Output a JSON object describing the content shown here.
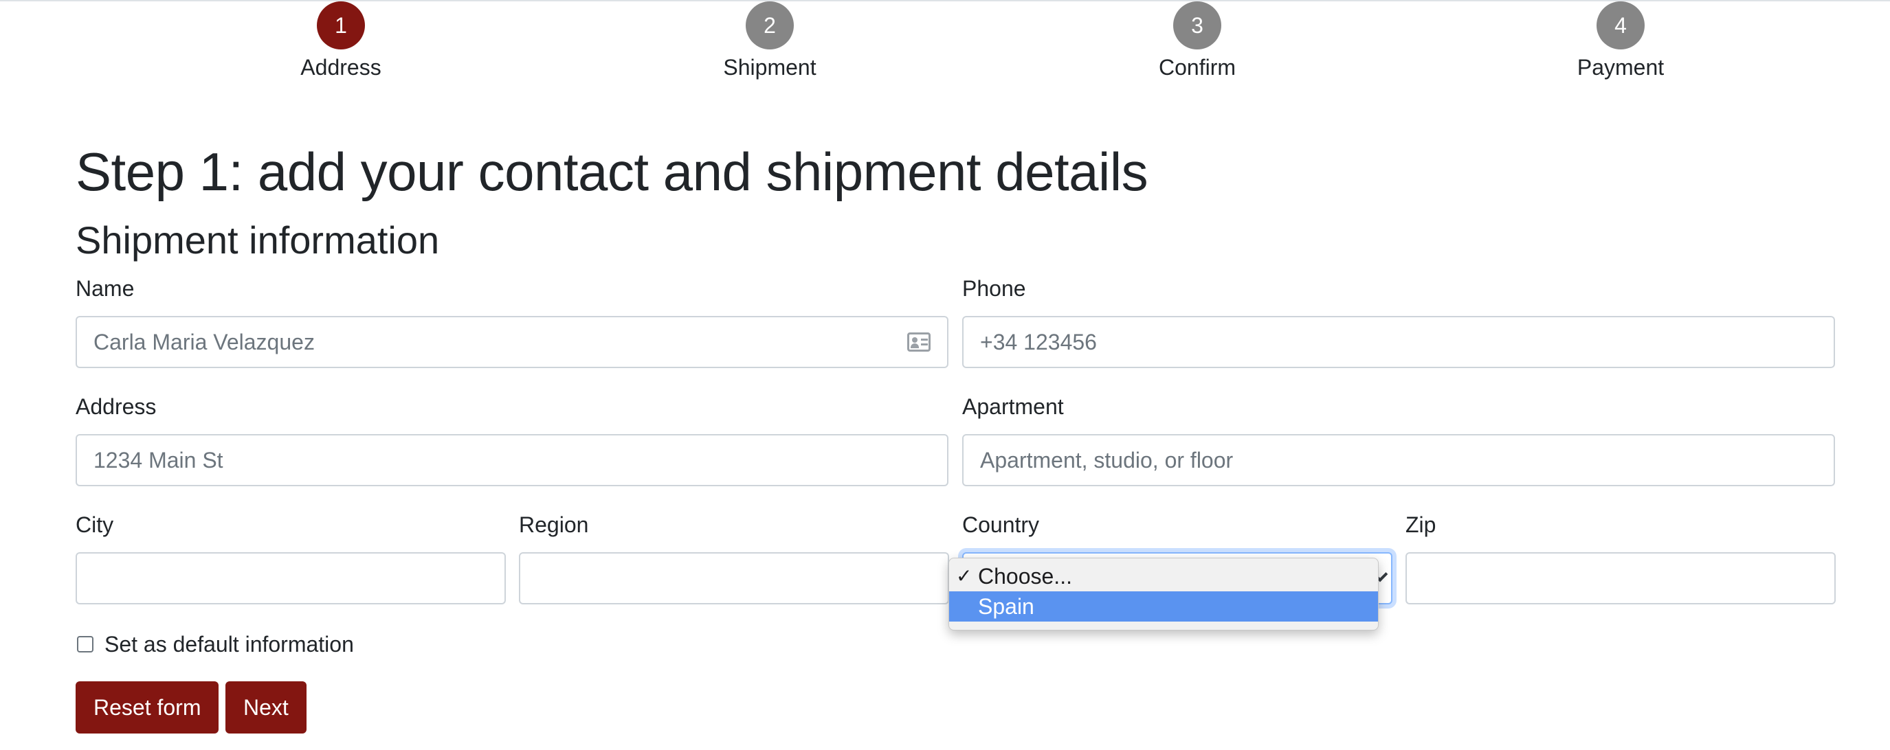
{
  "colors": {
    "accent": "#831611",
    "step_inactive": "#868686",
    "option_highlight": "#5a93f0"
  },
  "stepper": {
    "steps": [
      {
        "number": "1",
        "label": "Address",
        "active": true
      },
      {
        "number": "2",
        "label": "Shipment",
        "active": false
      },
      {
        "number": "3",
        "label": "Confirm",
        "active": false
      },
      {
        "number": "4",
        "label": "Payment",
        "active": false
      }
    ]
  },
  "page": {
    "title": "Step 1: add your contact and shipment details",
    "subtitle": "Shipment information"
  },
  "form": {
    "name": {
      "label": "Name",
      "placeholder": "Carla Maria Velazquez",
      "icon": "contact-card-icon"
    },
    "phone": {
      "label": "Phone",
      "placeholder": "+34 123456"
    },
    "address": {
      "label": "Address",
      "placeholder": "1234 Main St"
    },
    "apartment": {
      "label": "Apartment",
      "placeholder": "Apartment, studio, or floor"
    },
    "city": {
      "label": "City",
      "value": ""
    },
    "region": {
      "label": "Region",
      "value": ""
    },
    "country": {
      "label": "Country",
      "selected": "Choose...",
      "options": [
        {
          "label": "Choose...",
          "checked": true,
          "highlighted": false
        },
        {
          "label": "Spain",
          "checked": false,
          "highlighted": true
        }
      ]
    },
    "zip": {
      "label": "Zip",
      "value": ""
    },
    "default_checkbox": {
      "label": "Set as default information",
      "checked": false
    }
  },
  "buttons": {
    "reset": "Reset form",
    "next": "Next"
  }
}
